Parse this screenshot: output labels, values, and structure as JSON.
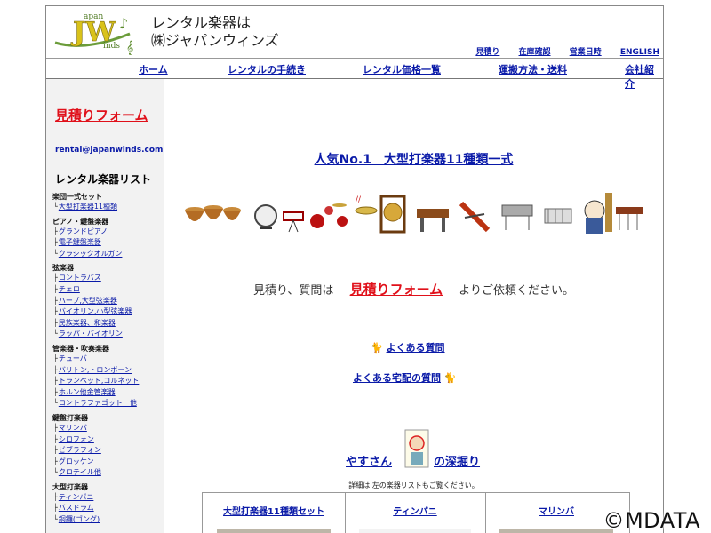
{
  "header": {
    "logo_text": "Japan winds",
    "company_line1": "レンタル楽器は",
    "company_line2": "㈱ジャパンウィンズ",
    "top_links": [
      "見積り",
      "在庫確認",
      "営業日時",
      "ENGLISH"
    ]
  },
  "nav": [
    "ホーム",
    "レンタルの手続き",
    "レンタル価格一覧",
    "運搬方法・送料",
    "会社紹介"
  ],
  "sidebar": {
    "quote_form": "見積りフォーム",
    "email": "rental@japanwinds.com",
    "list_title": "レンタル楽器リスト",
    "groups": [
      {
        "title": "楽団一式セット",
        "items": [
          "大型打楽器11種類"
        ]
      },
      {
        "title": "ピアノ・鍵盤楽器",
        "items": [
          "グランドピアノ",
          "電子鍵盤楽器",
          "クラシックオルガン"
        ]
      },
      {
        "title": "弦楽器",
        "items": [
          "コントラバス",
          "チェロ",
          "ハープ,大型弦楽器",
          "バイオリン,小型弦楽器",
          "民族楽器、和楽器",
          "ラッパ・バイオリン"
        ]
      },
      {
        "title": "管楽器・吹奏楽器",
        "items": [
          "チューバ",
          "バリトン,トロンボーン",
          "トランペット,コルネット",
          "ホルン他金管楽器",
          "コントラファゴット　他"
        ]
      },
      {
        "title": "鍵盤打楽器",
        "items": [
          "マリンバ",
          "シロフォン",
          "ビブラフォン",
          "グロッケン",
          "クロテイル他"
        ]
      },
      {
        "title": "大型打楽器",
        "items": [
          "ティンパニ",
          "バスドラム",
          "銅鑼(ゴング)"
        ]
      }
    ]
  },
  "main": {
    "headline": "人気No.1　大型打楽器11種類一式",
    "inquiry_pre": "見積り、質問は",
    "inquiry_link": "見積りフォーム",
    "inquiry_post": "よりご依頼ください。",
    "faq1": "よくある質問",
    "faq2": "よくある宅配の質問",
    "yasu_left": "やすさん",
    "yasu_right": "の深掘り",
    "yasu_caption": "詳細は 左の楽器リストもご覧ください。",
    "cards": [
      "大型打楽器11種類セット",
      "ティンパニ",
      "マリンバ"
    ]
  },
  "watermark": "©MDATA",
  "colors": {
    "link": "#0a1aa8",
    "accent_red": "#e0101a",
    "sidebar_bg": "#f2f2f2",
    "logo_green": "#5a8a2a"
  }
}
